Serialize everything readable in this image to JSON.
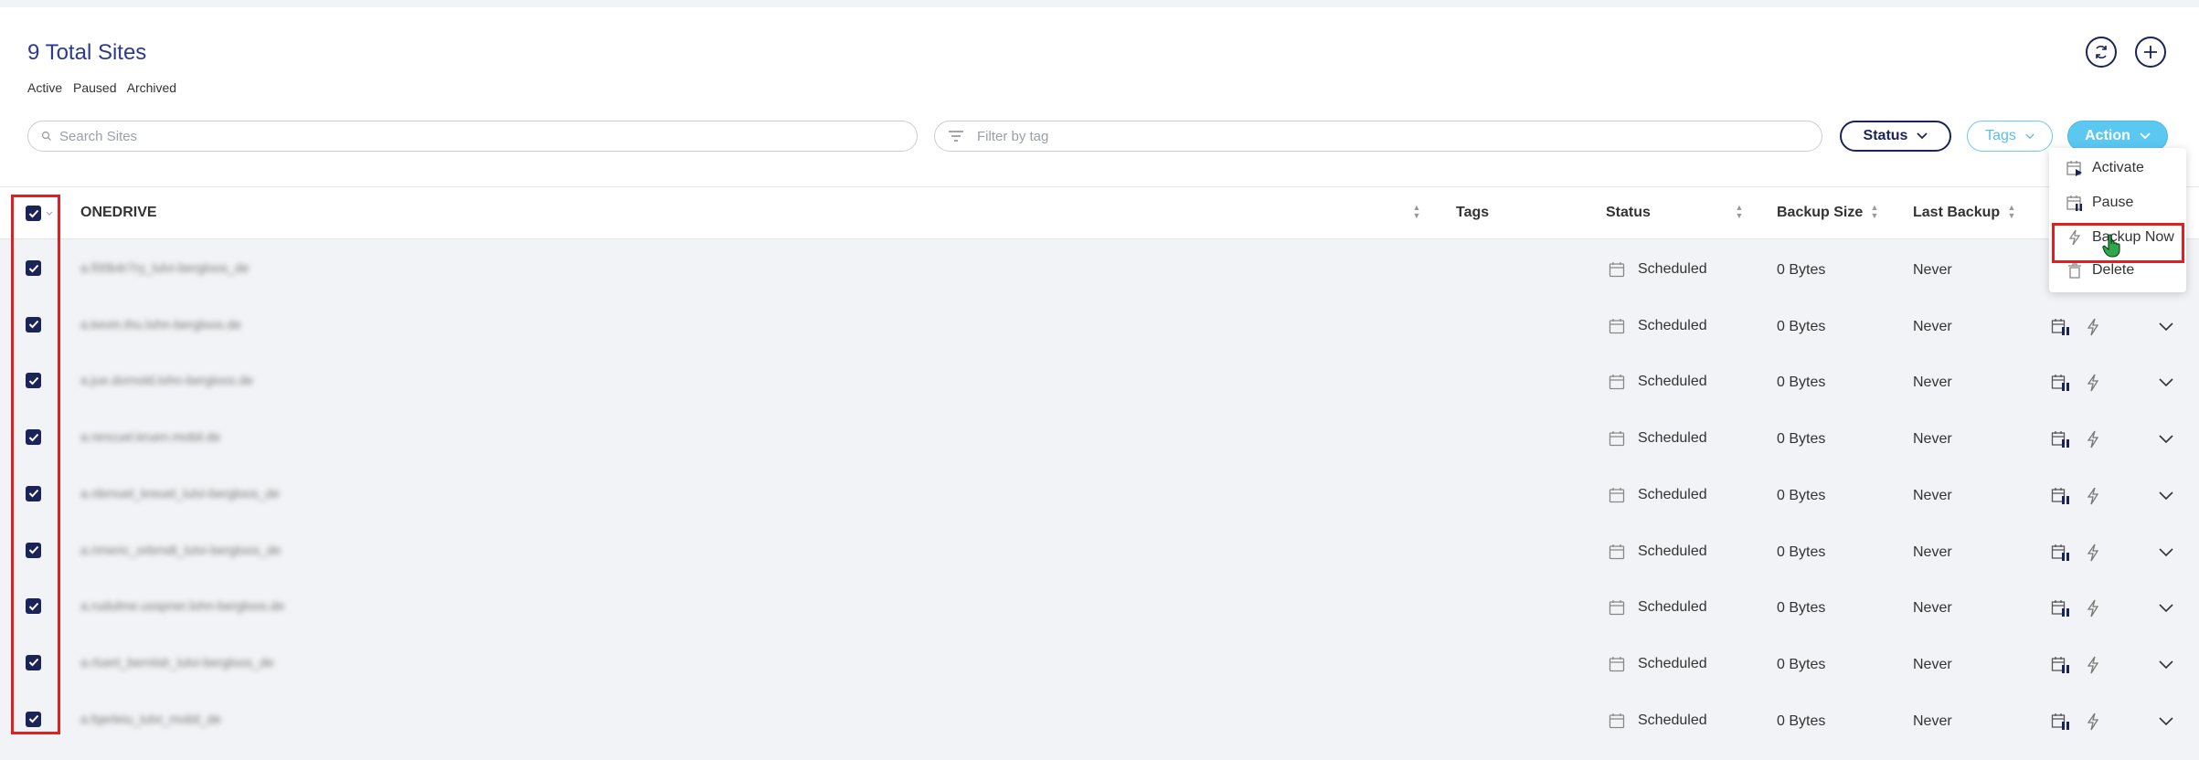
{
  "header": {
    "title": "9 Total Sites",
    "filters": [
      "Active",
      "Paused",
      "Archived"
    ]
  },
  "toolbar": {
    "search_placeholder": "Search Sites",
    "tag_placeholder": "Filter by tag",
    "status_label": "Status",
    "tags_label": "Tags",
    "action_label": "Action"
  },
  "table": {
    "columns": [
      "ONEDRIVE",
      "Tags",
      "Status",
      "Backup Size",
      "Last Backup"
    ],
    "rows": [
      {
        "site": "a.f00b4r7ry_lulvi-bergloos_de",
        "status": "Scheduled",
        "size": "0 Bytes",
        "last": "Never"
      },
      {
        "site": "a.kevin.thu.lohn-bergloos.de",
        "status": "Scheduled",
        "size": "0 Bytes",
        "last": "Never"
      },
      {
        "site": "a.jue.dornold.lohn-bergloos.de",
        "status": "Scheduled",
        "size": "0 Bytes",
        "last": "Never"
      },
      {
        "site": "a.rencuel.kruen.mobil.de",
        "status": "Scheduled",
        "size": "0 Bytes",
        "last": "Never"
      },
      {
        "site": "a.nbrnuel_kreuel_lulvi-bergloos_de",
        "status": "Scheduled",
        "size": "0 Bytes",
        "last": "Never"
      },
      {
        "site": "a.rimeric_orbrndt_lulvi-bergloos_de",
        "status": "Scheduled",
        "size": "0 Bytes",
        "last": "Never"
      },
      {
        "site": "a.rudulme.usspner.lohn-bergloos.de",
        "status": "Scheduled",
        "size": "0 Bytes",
        "last": "Never"
      },
      {
        "site": "a.rluert_bernlstr_lulvi-bergloos_de",
        "status": "Scheduled",
        "size": "0 Bytes",
        "last": "Never"
      },
      {
        "site": "a.fqerleiu_lulvi_mobil_de",
        "status": "Scheduled",
        "size": "0 Bytes",
        "last": "Never"
      }
    ]
  },
  "action_menu": {
    "items": [
      "Activate",
      "Pause",
      "Backup Now",
      "Delete"
    ]
  },
  "colors": {
    "navy": "#1a2458",
    "accent": "#5bc8f2",
    "highlight": "#e02020"
  }
}
